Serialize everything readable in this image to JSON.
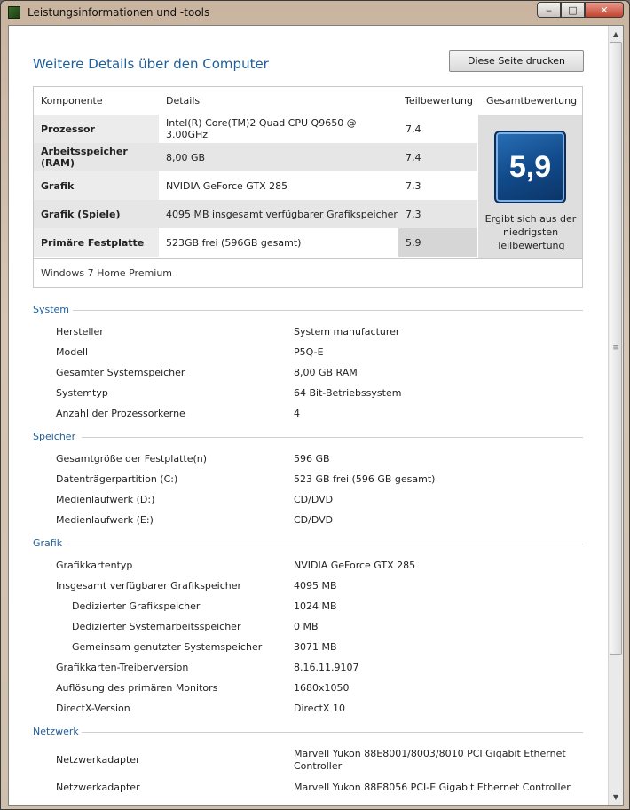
{
  "window": {
    "title": "Leistungsinformationen und -tools",
    "min": "‒",
    "max": "□",
    "close": "✕"
  },
  "heading": "Weitere Details über den Computer",
  "print_button": "Diese Seite drucken",
  "score_table": {
    "headers": {
      "component": "Komponente",
      "details": "Details",
      "subscore": "Teilbewertung",
      "total": "Gesamtbewertung"
    },
    "rows": [
      {
        "component": "Prozessor",
        "details": "Intel(R) Core(TM)2 Quad CPU Q9650 @ 3.00GHz",
        "subscore": "7,4"
      },
      {
        "component": "Arbeitsspeicher (RAM)",
        "details": "8,00 GB",
        "subscore": "7,4"
      },
      {
        "component": "Grafik",
        "details": "NVIDIA GeForce GTX 285",
        "subscore": "7,3"
      },
      {
        "component": "Grafik (Spiele)",
        "details": "4095 MB insgesamt verfügbarer Grafikspeicher",
        "subscore": "7,3"
      },
      {
        "component": "Primäre Festplatte",
        "details": "523GB frei (596GB gesamt)",
        "subscore": "5,9"
      }
    ],
    "total_score": "5,9",
    "total_caption": "Ergibt sich aus der niedrigsten Teilbewertung",
    "os": "Windows 7 Home Premium"
  },
  "sections": {
    "system": {
      "title": "System",
      "items": [
        {
          "label": "Hersteller",
          "value": "System manufacturer"
        },
        {
          "label": "Modell",
          "value": "P5Q-E"
        },
        {
          "label": "Gesamter Systemspeicher",
          "value": "8,00 GB RAM"
        },
        {
          "label": "Systemtyp",
          "value": "64 Bit-Betriebssystem"
        },
        {
          "label": "Anzahl der Prozessorkerne",
          "value": "4"
        }
      ]
    },
    "storage": {
      "title": "Speicher",
      "items": [
        {
          "label": "Gesamtgröße der Festplatte(n)",
          "value": "596 GB"
        },
        {
          "label": "Datenträgerpartition (C:)",
          "value": "523 GB frei (596 GB gesamt)"
        },
        {
          "label": "Medienlaufwerk (D:)",
          "value": "CD/DVD"
        },
        {
          "label": "Medienlaufwerk (E:)",
          "value": "CD/DVD"
        }
      ]
    },
    "graphics": {
      "title": "Grafik",
      "items": [
        {
          "label": "Grafikkartentyp",
          "value": "NVIDIA GeForce GTX 285"
        },
        {
          "label": "Insgesamt verfügbarer Grafikspeicher",
          "value": "4095 MB"
        },
        {
          "label": "Dedizierter Grafikspeicher",
          "value": "1024 MB"
        },
        {
          "label": "Dedizierter Systemarbeitsspeicher",
          "value": "0 MB"
        },
        {
          "label": "Gemeinsam genutzter Systemspeicher",
          "value": "3071 MB"
        },
        {
          "label": "Grafikkarten-Treiberversion",
          "value": "8.16.11.9107"
        },
        {
          "label": "Auflösung des primären Monitors",
          "value": "1680x1050"
        },
        {
          "label": "DirectX-Version",
          "value": "DirectX 10"
        }
      ]
    },
    "network": {
      "title": "Netzwerk",
      "items": [
        {
          "label": "Netzwerkadapter",
          "value": "Marvell Yukon 88E8001/8003/8010 PCI Gigabit Ethernet Controller"
        },
        {
          "label": "Netzwerkadapter",
          "value": "Marvell Yukon 88E8056 PCI-E Gigabit Ethernet Controller"
        }
      ]
    }
  },
  "scrollbar": {
    "up": "▲",
    "down": "▼",
    "grip": "≡"
  }
}
